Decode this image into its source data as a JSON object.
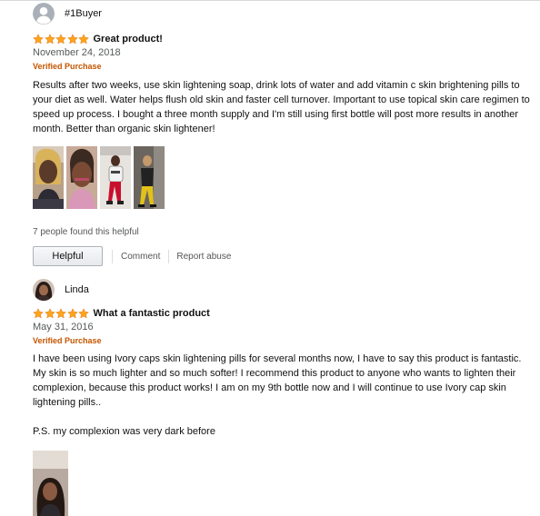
{
  "colors": {
    "star": "#ffa41c",
    "verified": "#c45500",
    "muted": "#565959",
    "link": "#555555"
  },
  "reviews": [
    {
      "profile_name": "#1Buyer",
      "avatar_icon": "default-user-icon",
      "stars": 5,
      "title": "Great product!",
      "date": "November 24, 2018",
      "verified": "Verified Purchase",
      "body": [
        "Results after two weeks, use skin lightening soap, drink lots of water and add vitamin c skin brightening pills to your diet as well. Water helps flush old skin and faster cell turnover. Important to use topical skin care regimen to speed up process. I bought a three month supply and I'm still using first bottle will post more results in another month. Better than organic skin lightener!"
      ],
      "image_count": 4,
      "helpful_count": "7 people found this helpful",
      "helpful_label": "Helpful",
      "comment_label": "Comment",
      "report_label": "Report abuse"
    },
    {
      "profile_name": "Linda",
      "avatar_icon": "user-photo",
      "stars": 5,
      "title": "What a fantastic product",
      "date": "May 31, 2016",
      "verified": "Verified Purchase",
      "body": [
        "I have been using Ivory caps skin lightening pills for several months now, I have to say this product is fantastic. My skin is so much lighter and so much softer! I recommend this product to anyone who wants to lighten their complexion, because this product works! I am on my 9th bottle now and I will continue to use Ivory cap skin lightening pills..",
        "P.S. my complexion was very dark before"
      ],
      "image_count": 1
    }
  ]
}
